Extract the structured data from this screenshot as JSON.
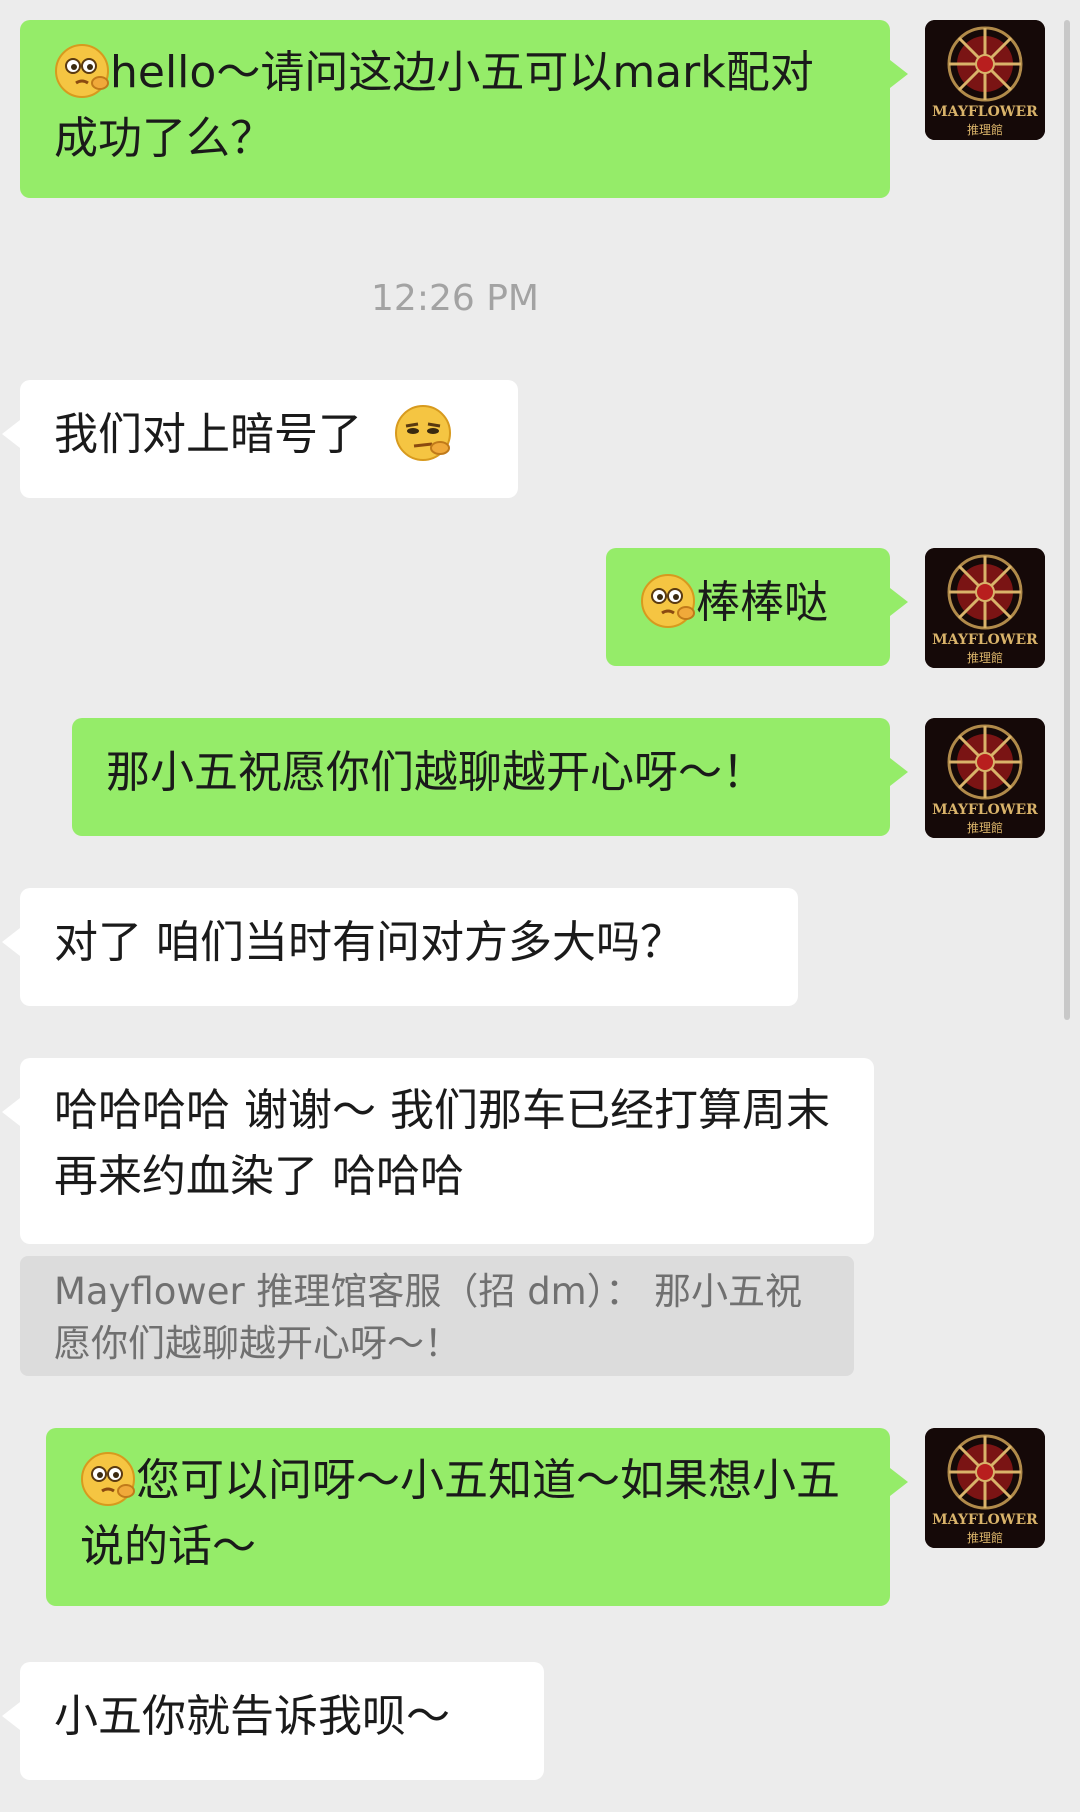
{
  "messages": [
    {
      "side": "out",
      "emoji": "thinking-face-icon",
      "text": "hello～请问这边小五可以mark配对成功了么？"
    },
    {
      "side": "in",
      "text": "我们对上暗号了",
      "emoji_after": "smug-face-icon"
    },
    {
      "side": "out",
      "emoji": "thinking-face-icon",
      "text": "棒棒哒"
    },
    {
      "side": "out",
      "text": "那小五祝愿你们越聊越开心呀～！"
    },
    {
      "side": "in",
      "text": "对了 咱们当时有问对方多大吗？"
    },
    {
      "side": "in",
      "text": "哈哈哈哈 谢谢～ 我们那车已经打算周末再来约血染了 哈哈哈"
    },
    {
      "side": "out",
      "emoji": "thinking-face-icon",
      "text": "您可以问呀～小五知道～如果想小五说的话～"
    },
    {
      "side": "in",
      "text": "小五你就告诉我呗～"
    }
  ],
  "timestamp": "12:26 PM",
  "quote": {
    "text": "Mayflower 推理馆客服（招 dm）： 那小五祝愿你们越聊越开心呀～！"
  },
  "avatar": {
    "line1": "MAYFLOWER",
    "line2": "推理館"
  },
  "colors": {
    "outgoing": "#95ec69",
    "incoming": "#ffffff",
    "background": "#ececec",
    "quote_bg": "#dcdcdc"
  }
}
